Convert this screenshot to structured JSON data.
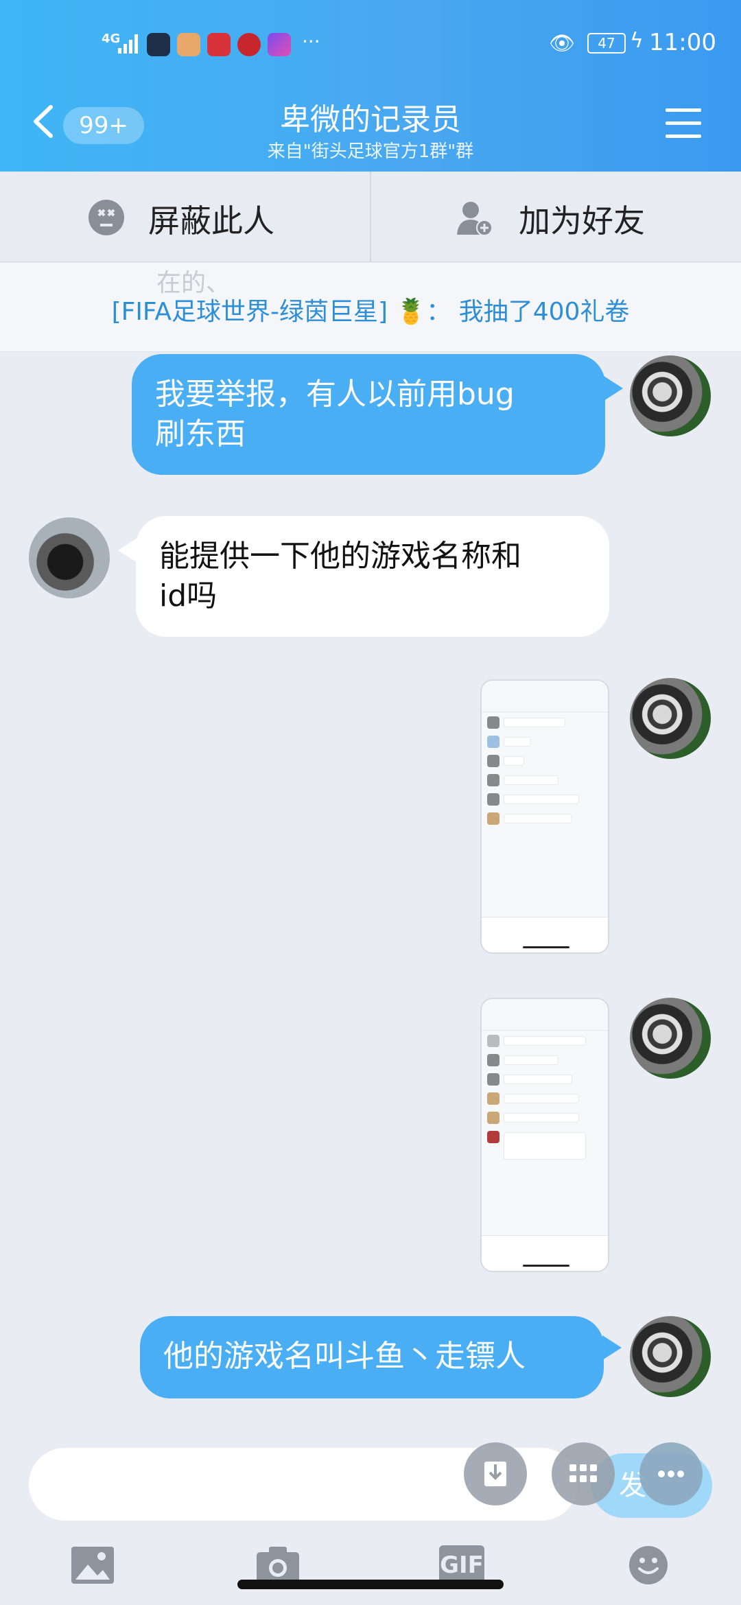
{
  "status_bar": {
    "network": "4G",
    "dots": "···",
    "battery": "47",
    "time": "11:00"
  },
  "header": {
    "unread_badge": "99+",
    "title": "卑微的记录员",
    "subtitle": "来自\"街头足球官方1群\"群"
  },
  "actions": {
    "block_label": "屏蔽此人",
    "add_friend_label": "加为好友"
  },
  "banner": {
    "ghost_text": "在的、",
    "text": "[FIFA足球世界-绿茵巨星] 🍍： 我抽了400礼卷"
  },
  "messages": [
    {
      "side": "right",
      "text_line1": "我要举报，有人以前用bug",
      "text_line2": "刷东西"
    },
    {
      "side": "left",
      "text_line1": "能提供一下他的游戏名称和",
      "text_line2": "id吗"
    },
    {
      "side": "right",
      "type": "image"
    },
    {
      "side": "right",
      "type": "image"
    },
    {
      "side": "right",
      "text_line1": "他的游戏名叫斗鱼丶走镖人"
    }
  ],
  "input": {
    "send_label": "发"
  },
  "toolbar": {
    "gif_label": "GIF"
  },
  "icons": [
    "back-chevron-icon",
    "menu-icon",
    "block-face-icon",
    "add-friend-icon",
    "pineapple-icon",
    "download-icon",
    "grid-icon",
    "more-icon",
    "image-icon",
    "camera-icon",
    "gif-icon",
    "emoji-icon"
  ]
}
